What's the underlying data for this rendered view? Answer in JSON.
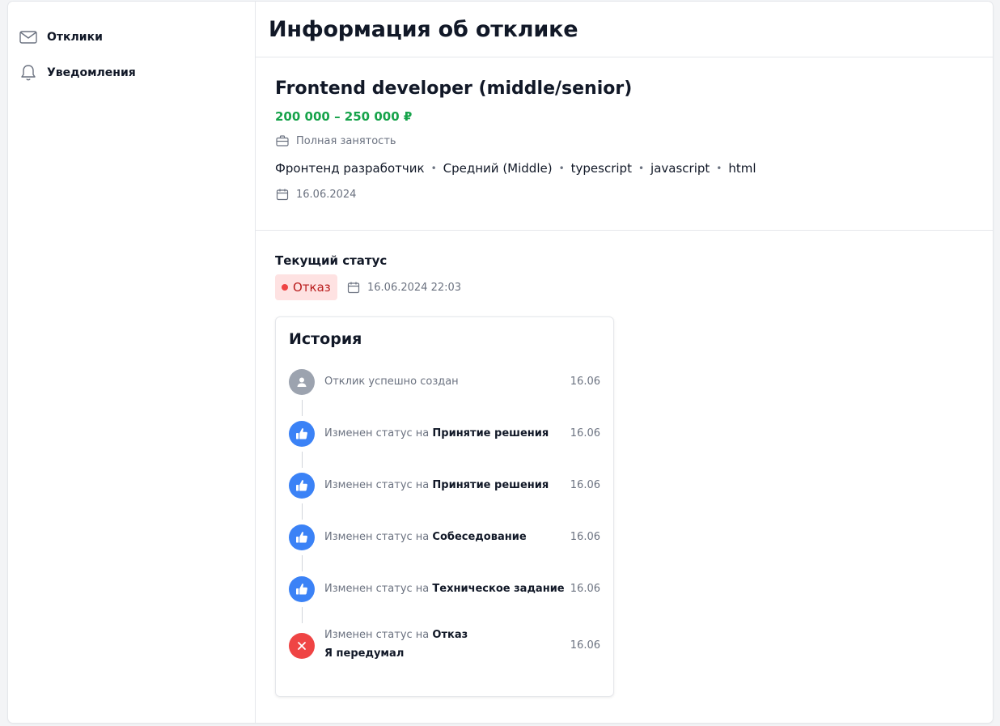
{
  "sidebar": {
    "items": [
      {
        "label": "Отклики",
        "icon": "mail-icon"
      },
      {
        "label": "Уведомления",
        "icon": "bell-icon"
      }
    ]
  },
  "page": {
    "title": "Информация об отклике"
  },
  "vacancy": {
    "title": "Frontend developer (middle/senior)",
    "salary": "200 000 – 250 000 ₽",
    "employment": "Полная занятость",
    "tags": [
      "Фронтенд разработчик",
      "Средний (Middle)",
      "typescript",
      "javascript",
      "html"
    ],
    "date": "16.06.2024"
  },
  "status": {
    "label": "Текущий статус",
    "value": "Отказ",
    "datetime": "16.06.2024 22:03"
  },
  "history": {
    "title": "История",
    "events": [
      {
        "text": "Отклик успешно создан",
        "bold": "",
        "note": "",
        "date": "16.06",
        "type": "user"
      },
      {
        "text": "Изменен статус на ",
        "bold": "Принятие решения",
        "note": "",
        "date": "16.06",
        "type": "like"
      },
      {
        "text": "Изменен статус на ",
        "bold": "Принятие решения",
        "note": "",
        "date": "16.06",
        "type": "like"
      },
      {
        "text": "Изменен статус на ",
        "bold": "Собеседование",
        "note": "",
        "date": "16.06",
        "type": "like"
      },
      {
        "text": "Изменен статус на ",
        "bold": "Техническое задание",
        "note": "",
        "date": "16.06",
        "type": "like"
      },
      {
        "text": "Изменен статус на ",
        "bold": "Отказ",
        "note": "Я передумал",
        "date": "16.06",
        "type": "reject"
      }
    ]
  },
  "colors": {
    "salary": "#16a34a",
    "badge_bg": "#fee2e2",
    "badge_text": "#b91c1c",
    "like": "#3b82f6",
    "reject": "#ef4444",
    "user": "#9ca3af"
  }
}
